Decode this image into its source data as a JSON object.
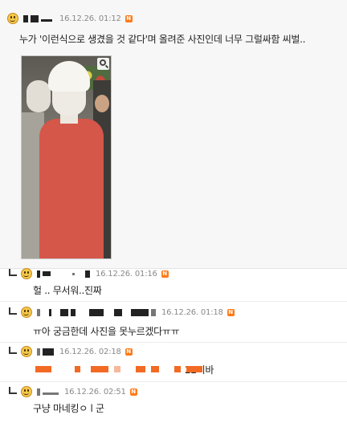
{
  "comments": [
    {
      "date": "16.12.26. 01:12",
      "badge": "N",
      "text": "누가 '이런식으로 생겼을 것 같다'며 올려준 사진인데 너무 그럴싸함 씨벌..",
      "photo": {
        "zoom_icon": "magnifier-icon"
      }
    },
    {
      "date": "16.12.26. 01:16",
      "badge": "N",
      "text": "헐 .. 무서워..진짜"
    },
    {
      "date": "16.12.26. 01:18",
      "badge": "N",
      "text": "ㅠ아 궁금한데 사진을 못누르겠다ㅠㅠ"
    },
    {
      "date": "16.12.26. 02:18",
      "badge": "N",
      "text": "22시바"
    },
    {
      "date": "16.12.26. 02:51",
      "badge": "N",
      "text": "구냥 마네킹ㅇ l 군"
    }
  ],
  "colors": {
    "badge": "#ff7a18",
    "top_bg": "#f7f7f7",
    "highlight": "#f26a24"
  }
}
